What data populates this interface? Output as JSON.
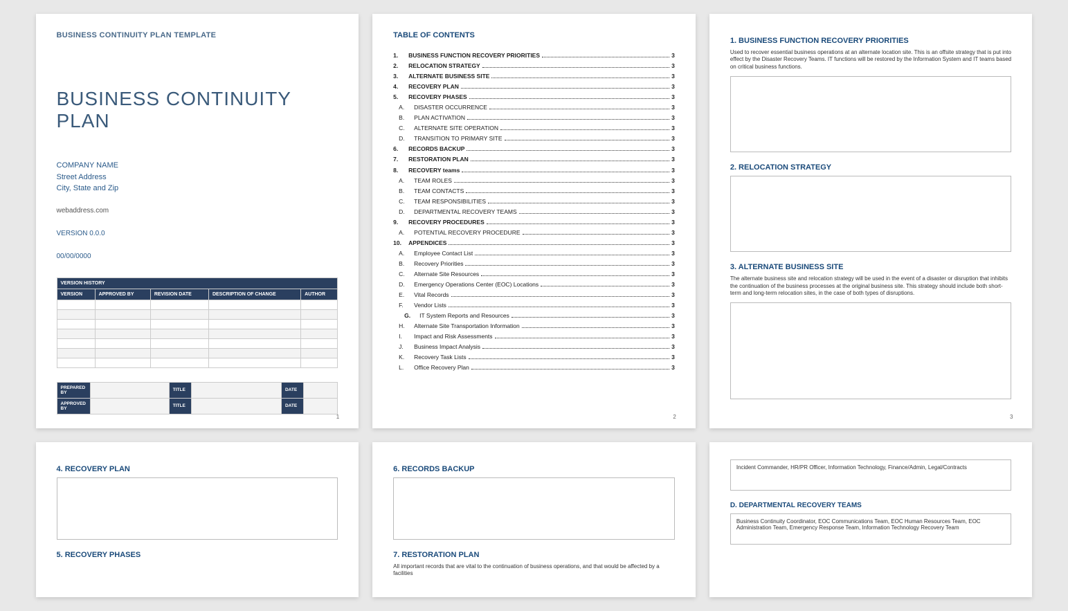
{
  "page1": {
    "template_label": "BUSINESS CONTINUITY PLAN TEMPLATE",
    "title": "BUSINESS CONTINUITY PLAN",
    "company_name": "COMPANY NAME",
    "street": "Street Address",
    "city": "City, State and Zip",
    "web": "webaddress.com",
    "version": "VERSION 0.0.0",
    "date": "00/00/0000",
    "history_header": "VERSION HISTORY",
    "cols": {
      "version": "VERSION",
      "approved_by": "APPROVED BY",
      "revision_date": "REVISION DATE",
      "desc": "DESCRIPTION OF CHANGE",
      "author": "AUTHOR"
    },
    "sign": {
      "prepared_by": "PREPARED BY",
      "approved_by": "APPROVED BY",
      "title": "TITLE",
      "date": "DATE"
    },
    "pagenum": "1"
  },
  "page2": {
    "toc_title": "TABLE OF CONTENTS",
    "items": [
      {
        "n": "1.",
        "label": "BUSINESS FUNCTION RECOVERY PRIORITIES",
        "pg": "3",
        "cls": "toc-top"
      },
      {
        "n": "2.",
        "label": "RELOCATION STRATEGY",
        "pg": "3",
        "cls": "toc-top"
      },
      {
        "n": "3.",
        "label": "ALTERNATE BUSINESS SITE",
        "pg": "3",
        "cls": "toc-top"
      },
      {
        "n": "4.",
        "label": "RECOVERY PLAN",
        "pg": "3",
        "cls": "toc-top"
      },
      {
        "n": "5.",
        "label": "RECOVERY PHASES",
        "pg": "3",
        "cls": "toc-top"
      },
      {
        "n": "A.",
        "label": "DISASTER OCCURRENCE",
        "pg": "3",
        "cls": "toc-sub"
      },
      {
        "n": "B.",
        "label": "PLAN ACTIVATION",
        "pg": "3",
        "cls": "toc-sub"
      },
      {
        "n": "C.",
        "label": "ALTERNATE SITE OPERATION",
        "pg": "3",
        "cls": "toc-sub"
      },
      {
        "n": "D.",
        "label": "TRANSITION TO PRIMARY SITE",
        "pg": "3",
        "cls": "toc-sub"
      },
      {
        "n": "6.",
        "label": "RECORDS BACKUP",
        "pg": "3",
        "cls": "toc-top"
      },
      {
        "n": "7.",
        "label": "RESTORATION PLAN",
        "pg": "3",
        "cls": "toc-top"
      },
      {
        "n": "8.",
        "label": "RECOVERY teams",
        "pg": "3",
        "cls": "toc-top"
      },
      {
        "n": "A.",
        "label": "TEAM ROLES",
        "pg": "3",
        "cls": "toc-sub"
      },
      {
        "n": "B.",
        "label": "TEAM CONTACTS",
        "pg": "3",
        "cls": "toc-sub"
      },
      {
        "n": "C.",
        "label": "TEAM RESPONSIBILITIES",
        "pg": "3",
        "cls": "toc-sub"
      },
      {
        "n": "D.",
        "label": "DEPARTMENTAL RECOVERY TEAMS",
        "pg": "3",
        "cls": "toc-sub"
      },
      {
        "n": "9.",
        "label": "RECOVERY PROCEDURES",
        "pg": "3",
        "cls": "toc-top"
      },
      {
        "n": "A.",
        "label": "POTENTIAL RECOVERY PROCEDURE",
        "pg": "3",
        "cls": "toc-sub"
      },
      {
        "n": "10.",
        "label": "APPENDICES",
        "pg": "3",
        "cls": "toc-top"
      },
      {
        "n": "A.",
        "label": "Employee Contact List",
        "pg": "3",
        "cls": "toc-sub"
      },
      {
        "n": "B.",
        "label": "Recovery Priorities",
        "pg": "3",
        "cls": "toc-sub"
      },
      {
        "n": "C.",
        "label": "Alternate Site Resources",
        "pg": "3",
        "cls": "toc-sub"
      },
      {
        "n": "D.",
        "label": "Emergency Operations Center (EOC) Locations",
        "pg": "3",
        "cls": "toc-sub"
      },
      {
        "n": "E.",
        "label": "Vital Records",
        "pg": "3",
        "cls": "toc-sub"
      },
      {
        "n": "F.",
        "label": "Vendor Lists",
        "pg": "3",
        "cls": "toc-sub"
      },
      {
        "n": "G.",
        "label": "IT System Reports and Resources",
        "pg": "3",
        "cls": "toc-subsub"
      },
      {
        "n": "H.",
        "label": "Alternate Site Transportation Information",
        "pg": "3",
        "cls": "toc-sub"
      },
      {
        "n": "I.",
        "label": "Impact and Risk Assessments",
        "pg": "3",
        "cls": "toc-sub"
      },
      {
        "n": "J.",
        "label": "Business Impact Analysis",
        "pg": "3",
        "cls": "toc-sub"
      },
      {
        "n": "K.",
        "label": "Recovery Task Lists",
        "pg": "3",
        "cls": "toc-sub"
      },
      {
        "n": "L.",
        "label": "Office Recovery Plan",
        "pg": "3",
        "cls": "toc-sub"
      }
    ],
    "pagenum": "2"
  },
  "page3": {
    "s1": {
      "title": "1.  BUSINESS FUNCTION RECOVERY PRIORITIES",
      "body": "Used to recover essential business operations at an alternate location site. This is an offsite strategy that is put into effect by the Disaster Recovery Teams. IT functions will be restored by the Information System and IT teams based on critical business functions."
    },
    "s2": {
      "title": "2.  RELOCATION STRATEGY"
    },
    "s3": {
      "title": "3.  ALTERNATE BUSINESS SITE",
      "body": "The alternate business site and relocation strategy will be used in the event of a disaster or disruption that inhibits the continuation of the business processes at the original business site. This strategy should include both short-term and long-term relocation sites, in the case of both types of disruptions."
    },
    "pagenum": "3"
  },
  "page4": {
    "s4": {
      "title": "4.  RECOVERY PLAN"
    },
    "s5": {
      "title": "5.  RECOVERY PHASES"
    }
  },
  "page5": {
    "s6": {
      "title": "6.  RECORDS BACKUP"
    },
    "s7": {
      "title": "7.  RESTORATION PLAN",
      "body": "All important records that are vital to the continuation of business operations, and that would be affected by a facilities"
    }
  },
  "page6": {
    "box": "Incident Commander, HR/PR Officer, Information Technology, Finance/Admin, Legal/Contracts",
    "sub_d": {
      "title": "D.  DEPARTMENTAL RECOVERY TEAMS",
      "box": "Business Continuity Coordinator, EOC Communications Team, EOC Human Resources Team, EOC Administration Team, Emergency Response Team, Information Technology Recovery Team"
    }
  }
}
